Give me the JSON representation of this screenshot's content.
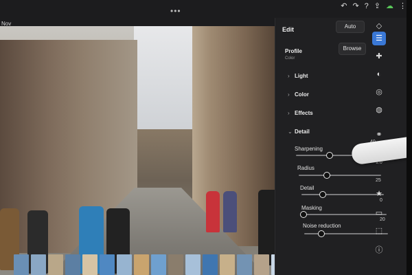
{
  "topbar": {
    "date_label": "Nov",
    "dots": "•••",
    "icons": [
      "undo-icon",
      "redo-icon",
      "help-icon",
      "share-icon",
      "cloud-sync-icon",
      "more-icon"
    ]
  },
  "panel": {
    "title": "Edit",
    "auto_label": "Auto",
    "profile_label": "Profile",
    "profile_value": "Color",
    "browse_label": "Browse",
    "sections": [
      {
        "label": "Light"
      },
      {
        "label": "Color"
      },
      {
        "label": "Effects"
      },
      {
        "label": "Detail"
      }
    ],
    "detail": {
      "sharpening": {
        "label": "Sharpening",
        "value": "40",
        "fraction": 0.4
      },
      "radius": {
        "label": "Radius",
        "value": "1.0",
        "fraction": 0.33
      },
      "detail": {
        "label": "Detail",
        "value": "25",
        "fraction": 0.25
      },
      "masking": {
        "label": "Masking",
        "value": "0",
        "fraction": 0.0
      },
      "noise_reduction": {
        "label": "Noise reduction",
        "value": "20",
        "fraction": 0.2
      }
    }
  },
  "rail": {
    "icons": [
      "eraser-icon",
      "sliders-icon",
      "healing-icon",
      "mask-icon",
      "geometry-icon",
      "optics-icon",
      "presets-icon",
      "star-icon",
      "comment-icon",
      "tag-icon",
      "info-icon"
    ],
    "active": "sliders-icon"
  },
  "colors": {
    "panel_bg": "#202022",
    "accent": "#3a78d6",
    "cloud": "#5ac85a"
  }
}
